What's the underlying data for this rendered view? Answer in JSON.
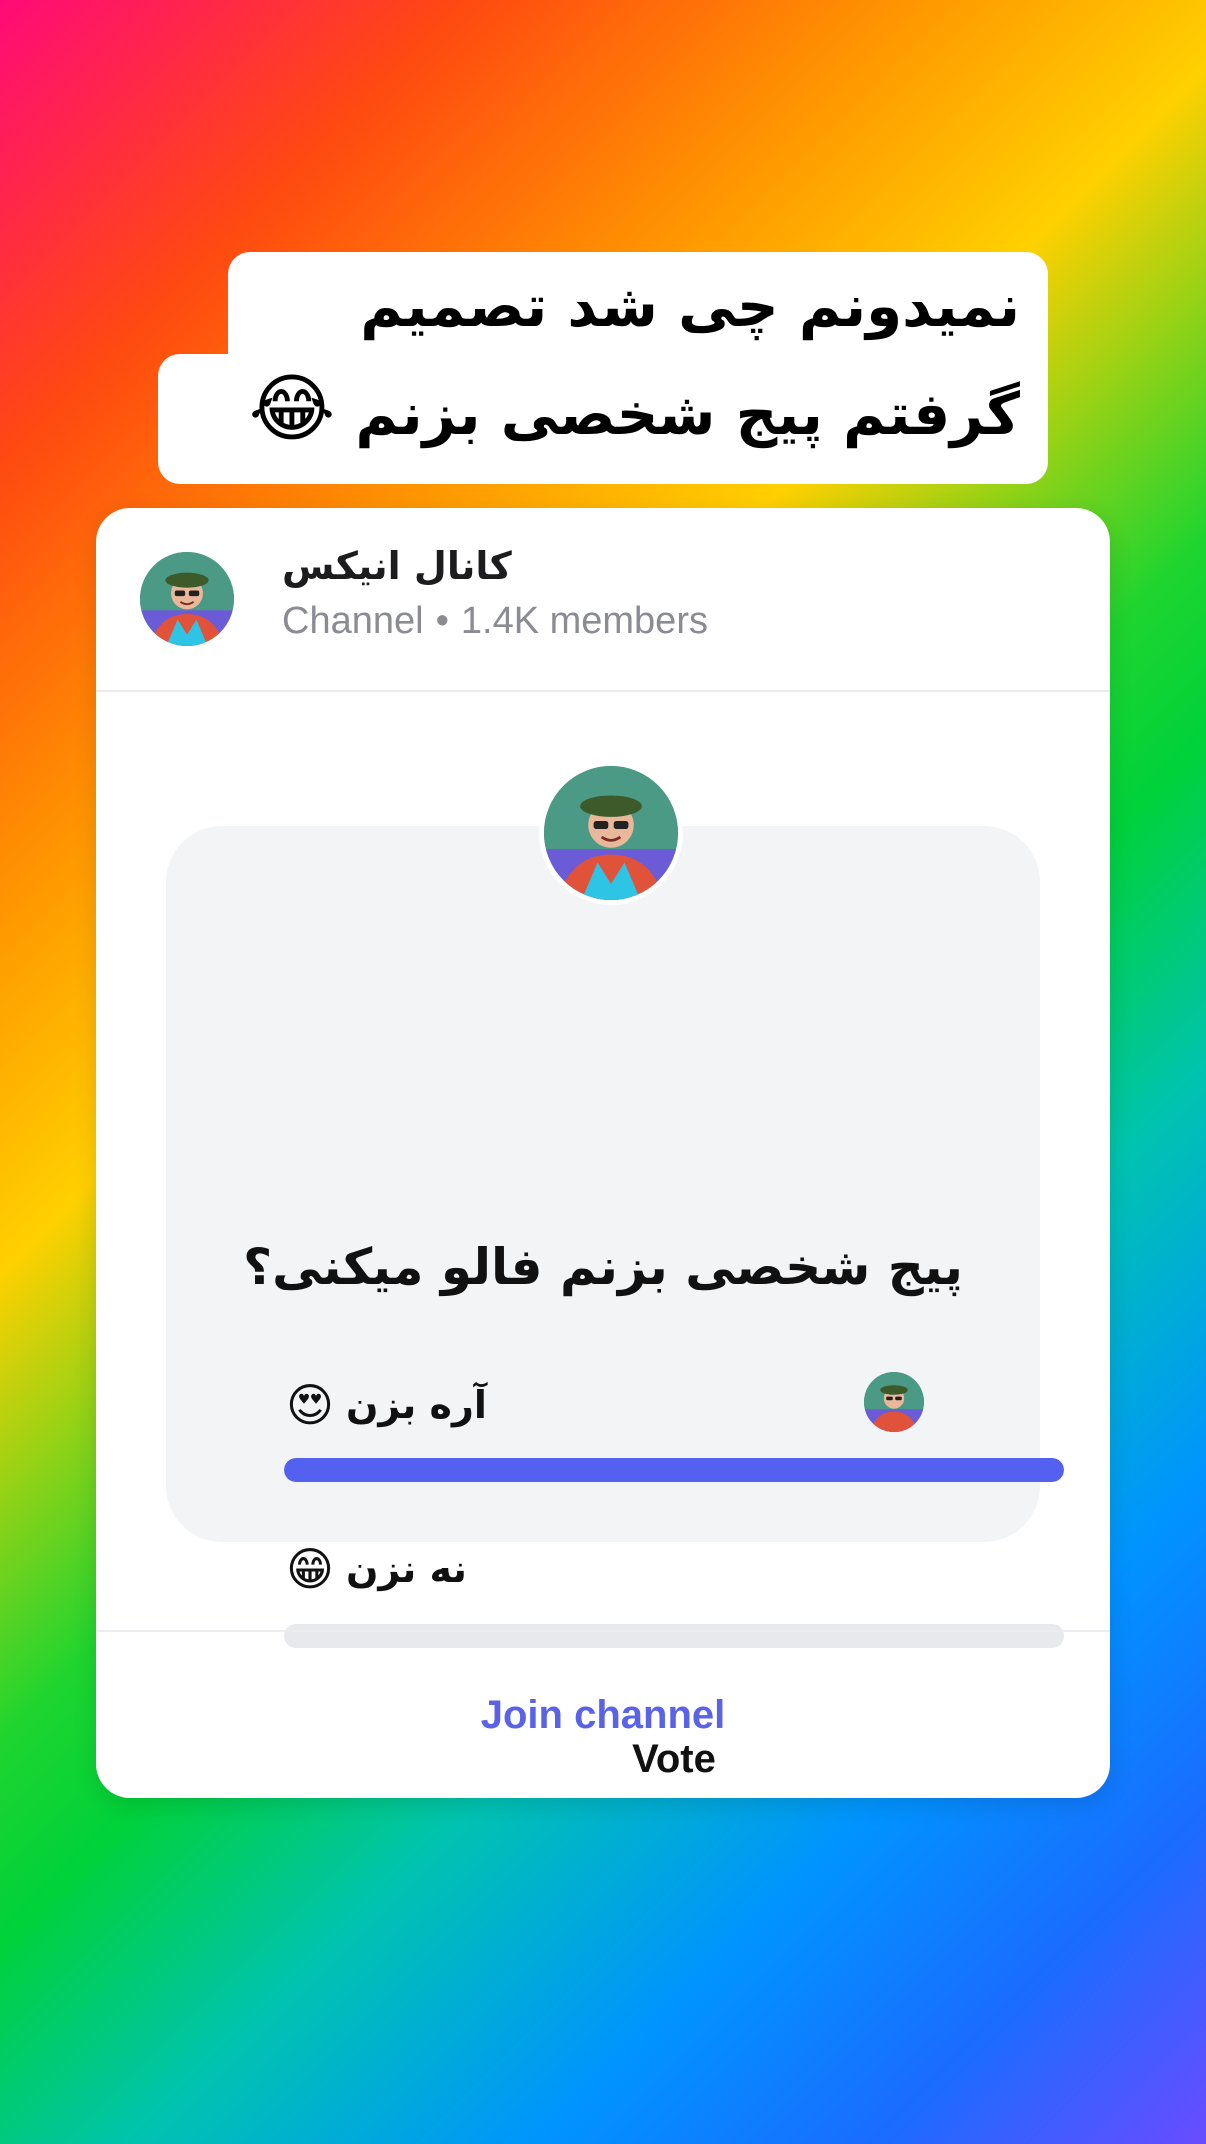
{
  "caption": {
    "line1": "نمیدونم چی شد تصمیم",
    "line2": "گرفتم پیج شخصی بزنم",
    "emoji": "😂"
  },
  "channel": {
    "name": "کانال انیکس",
    "type": "Channel",
    "separator": "•",
    "members": "1.4K members"
  },
  "poll": {
    "question": "پیج شخصی بزنم فالو میکنی؟",
    "options": [
      {
        "label": "آره بزن",
        "emoji": "😍",
        "fraction": 1.0
      },
      {
        "label": "نه نزن",
        "emoji": "😁",
        "fraction": 0.0
      }
    ],
    "vote_label": "Vote",
    "accent": "#5360f0"
  },
  "footer": {
    "join_label": "Join channel",
    "join_color": "#5a63e6"
  },
  "icons": {
    "avatar": "person-avatar"
  }
}
